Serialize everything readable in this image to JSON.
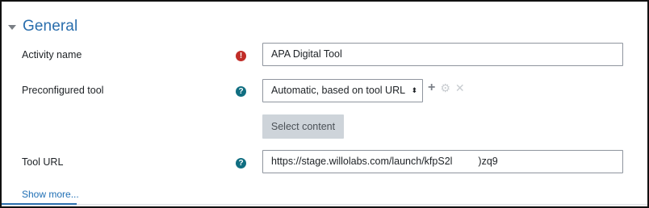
{
  "section": {
    "title": "General",
    "caret_icon": "caret-down-icon"
  },
  "fields": {
    "activity_name": {
      "label": "Activity name",
      "value": "APA Digital Tool",
      "status_icon": "required-icon",
      "icon_glyph": "!"
    },
    "preconfigured_tool": {
      "label": "Preconfigured tool",
      "selected": "Automatic, based on tool URL",
      "select_arrow": "⬍",
      "help_icon": "help-icon",
      "icon_glyph": "?",
      "action_icons": {
        "add": "+",
        "settings": "⚙",
        "remove": "✕"
      }
    },
    "select_content": {
      "label": "Select content"
    },
    "tool_url": {
      "label": "Tool URL",
      "value_start": "https://stage.willolabs.com/launch/kfpS2l",
      "value_end": ")zq9",
      "help_icon": "help-icon",
      "icon_glyph": "?"
    }
  },
  "footer": {
    "show_more": "Show more..."
  },
  "colors": {
    "section_title": "#2a6ead",
    "required_icon": "#c12d28",
    "help_icon": "#106e81",
    "link": "#1f6fb5",
    "disabled_button_bg": "#ced4da"
  }
}
